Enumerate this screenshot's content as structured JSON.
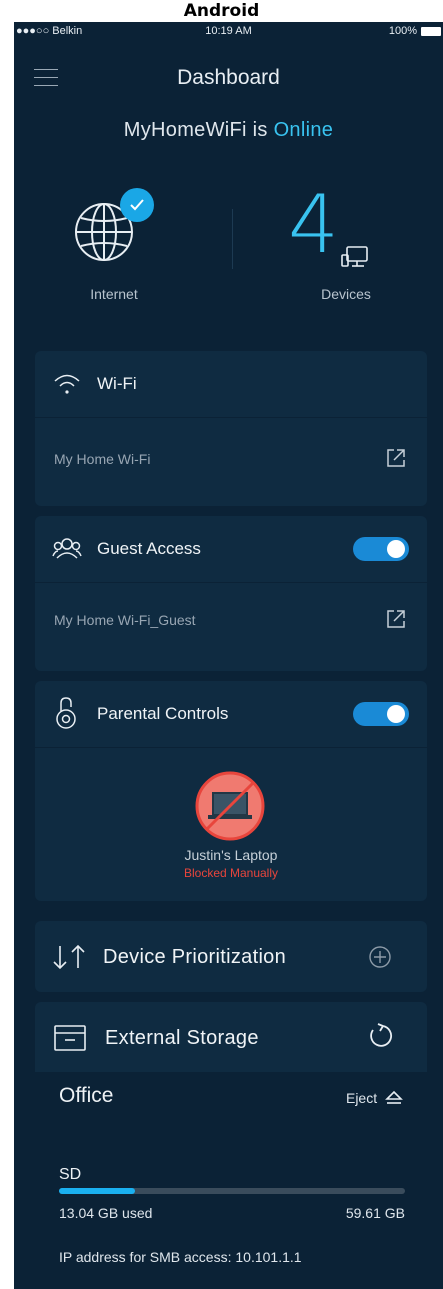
{
  "platform_label": "Android",
  "statusbar": {
    "carrier": "●●●○○ Belkin",
    "time": "10:19 AM",
    "battery": "100%"
  },
  "header": {
    "title": "Dashboard"
  },
  "network": {
    "name": "MyHomeWiFi",
    "connector": "is",
    "status": "Online"
  },
  "internet": {
    "label": "Internet"
  },
  "devices": {
    "count": "4",
    "label": "Devices"
  },
  "wifi": {
    "title": "Wi-Fi",
    "network_name": "My Home Wi-Fi"
  },
  "guest": {
    "title": "Guest Access",
    "network_name": "My Home Wi-Fi_Guest",
    "enabled": true
  },
  "parental": {
    "title": "Parental Controls",
    "enabled": true,
    "device_name": "Justin's Laptop",
    "device_status": "Blocked Manually"
  },
  "prioritization": {
    "title": "Device Prioritization"
  },
  "storage": {
    "title": "External Storage",
    "location": "Office",
    "eject_label": "Eject",
    "drive_label": "SD",
    "used": "13.04 GB used",
    "total": "59.61 GB",
    "used_fraction": 0.219,
    "smb_text": "IP address for SMB access: 10.101.1.1"
  },
  "colors": {
    "accent": "#39c3f0",
    "background": "#0b2236",
    "card": "#0f2b41",
    "toggle": "#1a8ad6",
    "blocked": "#e8453c"
  }
}
